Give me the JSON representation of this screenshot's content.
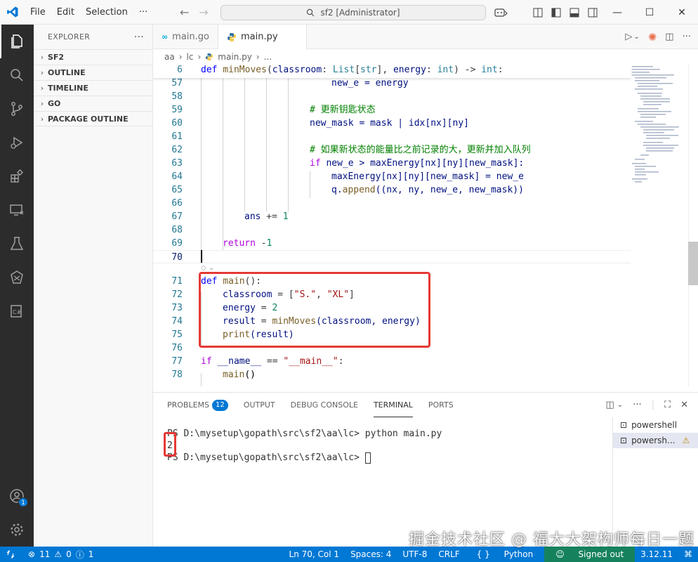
{
  "menu": {
    "file": "File",
    "edit": "Edit",
    "selection": "Selection",
    "more": "···"
  },
  "command_center": {
    "label": "sf2 [Administrator]"
  },
  "sidebar": {
    "title": "EXPLORER",
    "sections": [
      "SF2",
      "OUTLINE",
      "TIMELINE",
      "GO",
      "PACKAGE OUTLINE"
    ]
  },
  "tabs": [
    {
      "label": "main.go"
    },
    {
      "label": "main.py"
    }
  ],
  "breadcrumb": {
    "folder1": "aa",
    "folder2": "lc",
    "file": "main.py",
    "more": "..."
  },
  "editor": {
    "sticky": {
      "num": "6"
    },
    "lines": [
      {
        "num": "57"
      },
      {
        "num": "58"
      },
      {
        "num": "59"
      },
      {
        "num": "60"
      },
      {
        "num": "61"
      },
      {
        "num": "62"
      },
      {
        "num": "63"
      },
      {
        "num": "64"
      },
      {
        "num": "65"
      },
      {
        "num": "66"
      },
      {
        "num": "67"
      },
      {
        "num": "68"
      },
      {
        "num": "69"
      },
      {
        "num": "70"
      },
      {
        "num": "71"
      },
      {
        "num": "72"
      },
      {
        "num": "73"
      },
      {
        "num": "74"
      },
      {
        "num": "75"
      },
      {
        "num": "76"
      },
      {
        "num": "77"
      },
      {
        "num": "78"
      }
    ],
    "text": {
      "l57": "new_e = energy",
      "l59": "# 更新钥匙状态",
      "l60a": "new_mask",
      "l60b": " = mask | idx[nx][ny]",
      "l62": "# 如果新状态的能量比之前记录的大，更新并加入队列",
      "l63a": "if",
      "l63b": " new_e > maxEnergy[nx][ny][new_mask]:",
      "l64": "maxEnergy[nx][ny][new_mask] = new_e",
      "l65a": "q.",
      "l65b": "append",
      "l65c": "((nx, ny, new_e, new_mask))",
      "l67a": "ans",
      "l67b": " += ",
      "l67c": "1",
      "l69a": "return",
      "l69b": " -",
      "l69c": "1",
      "l71a": "def",
      "l71b": "main",
      "l71c": "():",
      "l72a": "classroom",
      "l72b": " = [",
      "l72c": "\"S.\"",
      "l72d": ", ",
      "l72e": "\"XL\"",
      "l72f": "]",
      "l73a": "energy",
      "l73b": " = ",
      "l73c": "2",
      "l74a": "result",
      "l74b": " = ",
      "l74c": "minMoves",
      "l74d": "(classroom, energy)",
      "l75a": "print",
      "l75b": "(result)",
      "l77a": "if",
      "l77b": " __name__",
      "l77c": " == ",
      "l77d": "\"__main__\"",
      "l77e": ":",
      "l78a": "main",
      "l78b": "()"
    },
    "sticky_text": {
      "a": "def",
      "b": "minMoves",
      "c": "(",
      "d": "classroom",
      "e": ": ",
      "f": "List",
      "g": "[",
      "h": "str",
      "i": "], ",
      "j": "energy",
      "k": ": ",
      "l": "int",
      "m": ") -> ",
      "n": "int",
      "o": ":"
    }
  },
  "panel": {
    "tabs": {
      "problems": "PROBLEMS",
      "problems_count": "12",
      "output": "OUTPUT",
      "debug": "DEBUG CONSOLE",
      "terminal": "TERMINAL",
      "ports": "PORTS"
    },
    "terminal_lines": [
      "PS D:\\mysetup\\gopath\\src\\sf2\\aa\\lc> python main.py",
      "2",
      "PS D:\\mysetup\\gopath\\src\\sf2\\aa\\lc> "
    ],
    "terminals": [
      "powershell",
      "powersh..."
    ]
  },
  "status": {
    "errors": "11",
    "warnings": "0",
    "info": "1",
    "position": "Ln 70, Col 1",
    "spaces": "Spaces: 4",
    "encoding": "UTF-8",
    "eol": "CRLF",
    "language": "Python",
    "account": "Signed out",
    "version": "3.12.11"
  },
  "watermark": "掘金技术社区 @ 福大大架构师每日一题",
  "accounts_badge": "1",
  "colors": {
    "accent": "#0078d4",
    "highlight_box": "#e53935",
    "activity_bg": "#2c2c2c"
  }
}
